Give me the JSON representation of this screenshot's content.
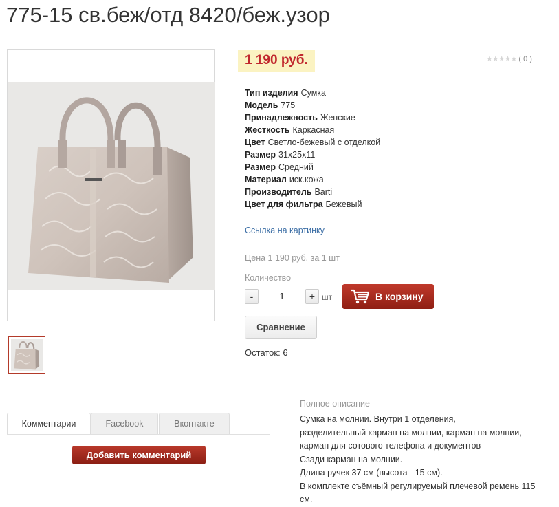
{
  "product": {
    "title": "775-15 св.беж/отд 8420/беж.узор",
    "price": "1 190 руб.",
    "rating_count": "( 0 )",
    "rating_stars": "★★★★★"
  },
  "properties": [
    {
      "label": "Тип изделия",
      "value": "Сумка"
    },
    {
      "label": "Модель",
      "value": "775"
    },
    {
      "label": "Принадлежность",
      "value": "Женские"
    },
    {
      "label": "Жесткость",
      "value": "Каркасная"
    },
    {
      "label": "Цвет",
      "value": "Светло-бежевый с отделкой"
    },
    {
      "label": "Размер",
      "value": "31х25х11"
    },
    {
      "label": "Размер",
      "value": "Средний"
    },
    {
      "label": "Материал",
      "value": "иск.кожа"
    },
    {
      "label": "Производитель",
      "value": "Barti"
    },
    {
      "label": "Цвет для фильтра",
      "value": "Бежевый"
    }
  ],
  "image_link": "Ссылка на картинку",
  "unit_price": "Цена 1 190 руб. за 1 шт",
  "quantity": {
    "label": "Количество",
    "minus": "-",
    "value": "1",
    "plus": "+",
    "unit": "шт"
  },
  "cart_button": "В корзину",
  "compare_button": "Сравнение",
  "stock": "Остаток: 6",
  "tabs": [
    "Комментарии",
    "Facebook",
    "Вконтакте"
  ],
  "add_comment_button": "Добавить комментарий",
  "description": {
    "title": "Полное описание",
    "lines": [
      "Сумка на молнии. Внутри 1 отделения,",
      "разделительный  карман на молнии, карман на молнии,",
      "карман для сотового телефона и документов",
      "Сзади карман на молнии.",
      "Длина ручек 37 см (высота - 15 см).",
      "В комплекте съёмный регулируемый плечевой ремень 115",
      "см."
    ]
  },
  "colors": {
    "price": "#c0272d",
    "price_bg": "#fbf3c2",
    "accent_button": "#a82c1f",
    "link": "#3d6fa6"
  },
  "icons": [
    "cart-icon",
    "star-icon"
  ]
}
